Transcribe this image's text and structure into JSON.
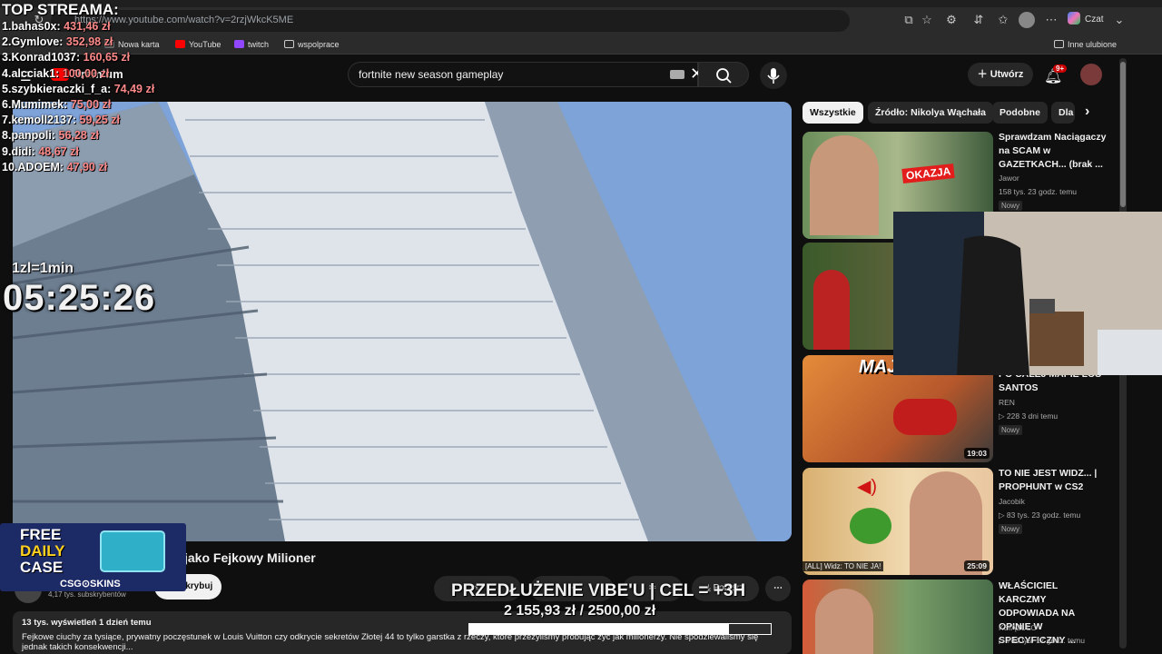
{
  "browser": {
    "url": "https://www.youtube.com/watch?v=2rzjWkcK5ME",
    "chat_label": "Czat",
    "bookmarks": [
      "Nowa karta",
      "YouTube",
      "twitch",
      "wspolprace"
    ],
    "other_favorites": "Inne ulubione"
  },
  "youtube": {
    "logo_suffix": "Premium",
    "search_value": "fortnite new season gameplay",
    "create_label": "Utwórz",
    "notif_count": "9+",
    "video_title": "jako Fejkowy Milioner",
    "subscribers": "4,17 tys. subskrybentów",
    "subscribe_label": "Subskrybuj",
    "download_label": "Pobierz",
    "description_meta": "13 tys. wyświetleń  1 dzień temu",
    "description_text": "Fejkowe ciuchy za tysiące, prywatny poczęstunek w Louis Vuitton czy odkrycie sekretów Złotej 44 to tylko garstka z rzeczy, które przeżyliśmy próbując żyć jak milionerzy. Nie spodziewaliśmy się jednak takich konsekwencji..."
  },
  "chips": [
    "Wszystkie",
    "Źródło: Nikolya Wąchała",
    "Podobne",
    "Dla"
  ],
  "recommendations": [
    {
      "title": "Sprawdzam Naciągaczy na SCAM w GAZETKACH... (brak ...",
      "channel": "Jawor",
      "views": "158 tys.",
      "age": "23 godz. temu",
      "badge": "Nowy",
      "duration": "",
      "thumb_text": "OKAZJA"
    },
    {
      "title": "",
      "channel": "",
      "views": "",
      "age": "",
      "badge": "",
      "duration": "",
      "thumb_text": ""
    },
    {
      "title": "PO CAŁEJ MAPIE LOS SANTOS",
      "channel": "REN",
      "views": "228",
      "age": "3 dni temu",
      "badge": "Nowy",
      "duration": "19:03",
      "thumb_text": "MAJSTER"
    },
    {
      "title": "TO NIE JEST WIDZ... | PROPHUNT w CS2",
      "channel": "Jacobik",
      "views": "83 tys.",
      "age": "23 godz. temu",
      "badge": "Nowy",
      "duration": "25:09",
      "thumb_text": "[ALL] Widz: TO NIE JA!"
    },
    {
      "title": "WŁAŚCICIEL KARCZMY ODPOWIADA NA OPINIE W SPECYFICZNY ...",
      "channel": "KSIĄŻULO",
      "views": "744 tys.",
      "age": "17 godz. temu",
      "badge": "",
      "duration": "",
      "thumb_text": ""
    }
  ],
  "overlay": {
    "leaderboard_title": "TOP STREAMA:",
    "leaderboard": [
      {
        "rank": "1.",
        "name": "bahas0x:",
        "amount": "431,46 zł"
      },
      {
        "rank": "2.",
        "name": "Gymlove:",
        "amount": "352,98 zł"
      },
      {
        "rank": "3.",
        "name": "Konrad1037:",
        "amount": "160,65 zł"
      },
      {
        "rank": "4.",
        "name": "alcciak1:",
        "amount": "100,00 zł"
      },
      {
        "rank": "5.",
        "name": "szybkieraczki_f_a:",
        "amount": "74,49 zł"
      },
      {
        "rank": "6.",
        "name": "Mumimek:",
        "amount": "75,00 zł"
      },
      {
        "rank": "7.",
        "name": "kemoll2137:",
        "amount": "59,25 zł"
      },
      {
        "rank": "8.",
        "name": "panpoli:",
        "amount": "56,28 zł"
      },
      {
        "rank": "9.",
        "name": "didi:",
        "amount": "48,67 zł"
      },
      {
        "rank": "10.",
        "name": "ADOEM:",
        "amount": "47,90 zł"
      }
    ],
    "timer_label": "1zl=1min",
    "timer": "05:25:26",
    "goal_title": "PRZEDŁUŻENIE VIBE'U | CEL = +3H",
    "goal_amount": "2 155,93 zł / 2500,00 zł",
    "goal_progress": 0.862,
    "promo_line1": "FREE",
    "promo_line2": "DAILY",
    "promo_line3": "CASE",
    "promo_brand": "CSG⊙SKINS"
  },
  "colors": {
    "youtube_red": "#ff0000",
    "accent_amount": "#ff8a8a",
    "promo_yellow": "#ffd21f"
  }
}
